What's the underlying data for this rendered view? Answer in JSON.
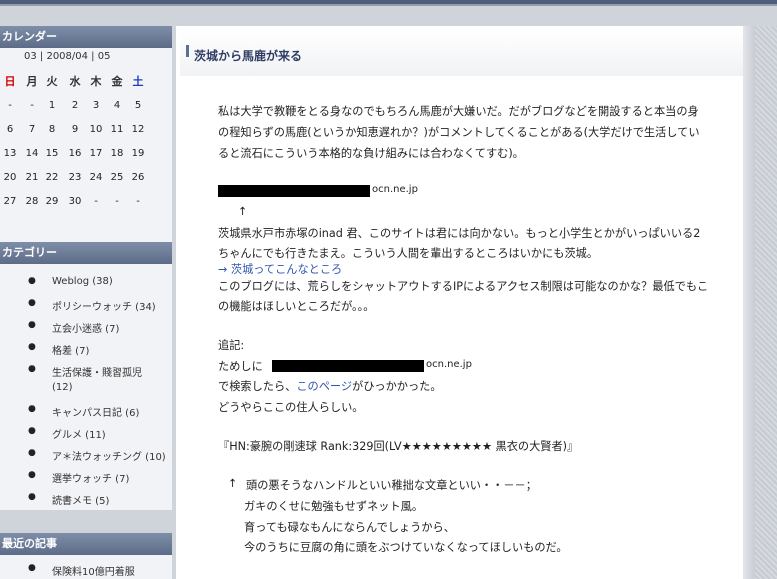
{
  "sidebar": {
    "calendar": {
      "heading": "カレンダー",
      "nav": "03 | 2008/04 | 05",
      "weekdays": [
        "日",
        "月",
        "火",
        "水",
        "木",
        "金",
        "土"
      ],
      "weeks": [
        [
          "-",
          "-",
          "1",
          "2",
          "3",
          "4",
          "5"
        ],
        [
          "6",
          "7",
          "8",
          "9",
          "10",
          "11",
          "12"
        ],
        [
          "13",
          "14",
          "15",
          "16",
          "17",
          "18",
          "19"
        ],
        [
          "20",
          "21",
          "22",
          "23",
          "24",
          "25",
          "26"
        ],
        [
          "27",
          "28",
          "29",
          "30",
          "-",
          "-",
          "-"
        ]
      ]
    },
    "categories": {
      "heading": "カテゴリー",
      "items": [
        "Weblog (38)",
        "ポリシーウォッチ (34)",
        "立会小迷惑 (7)",
        "格差 (7)",
        "生活保護・賤習孤児",
        "(12)",
        "キャンパス日記 (6)",
        "グルメ (11)",
        "ア＊法ウォッチング (10)",
        "選挙ウォッチ (7)",
        "読書メモ (5)"
      ]
    },
    "recent": {
      "heading": "最近の記事",
      "items": [
        "保険料10億円着服"
      ]
    }
  },
  "post": {
    "title": "茨城から馬鹿が来る",
    "para1": [
      "私は大学で教鞭をとる身なのでもちろん馬鹿が大嫌いだ。だがブログなどを開設すると本当の身",
      "の程知らずの馬鹿(というか知恵遅れか？)がコメントしてくることがある(大学だけで生活してい",
      "ると流石にこういう本格的な負け組みには合わなくてすむ)。"
    ],
    "host1_suffix": "ocn.ne.jp",
    "arrow": "↑",
    "para2": [
      "茨城県水戸市赤塚のinad 君、このサイトは君には向かない。もっと小学生とかがいっぱいいる2",
      "ちゃんにでも行きたまえ。こういう人間を輩出するところはいかにも茨城。"
    ],
    "link1": "→  茨城ってこんなところ",
    "para3": [
      "このブログには、荒らしをシャットアウトするIPによるアクセス制限は可能なのかな？最低でもこ",
      "の機能はほしいところだが。。。"
    ],
    "tsuiki": "追記:",
    "tameshi": "ためしに",
    "host2_suffix": "ocn.ne.jp",
    "search_prefix": "で検索したら、",
    "search_link": "このページ",
    "search_suffix": "がひっかかった。",
    "resident": "どうやらここの住人らしい。",
    "hn": "『HN:豪腕の剛速球 Rank:329回(LV★★★★★★★★★ 黒衣の大賢者)』",
    "quote_arrow": "↑",
    "quote": [
      "頭の悪そうなハンドルといい稚拙な文章といい・・－－；",
      "ガキのくせに勉強もせずネット風。",
      "育っても碌なもんにならんでしょうから、",
      "今のうちに豆腐の角に頭をぶつけていなくなってほしいものだ。"
    ]
  }
}
